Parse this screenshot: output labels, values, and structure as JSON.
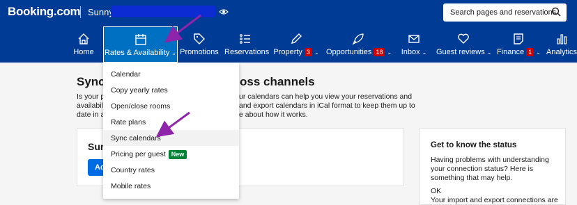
{
  "header": {
    "logo": "Booking.com",
    "property_name": "Sunny",
    "search_placeholder": "Search pages and reservations"
  },
  "nav": [
    {
      "label": "Home",
      "icon": "home-icon"
    },
    {
      "label": "Rates & Availability",
      "icon": "calendar-icon",
      "active": true
    },
    {
      "label": "Promotions",
      "icon": "tag-icon"
    },
    {
      "label": "Reservations",
      "icon": "list-icon"
    },
    {
      "label": "Property",
      "icon": "pencil-icon",
      "badge": "3"
    },
    {
      "label": "Opportunities",
      "icon": "rocket-icon",
      "badge": "18"
    },
    {
      "label": "Inbox",
      "icon": "envelope-icon"
    },
    {
      "label": "Guest reviews",
      "icon": "heart-icon"
    },
    {
      "label": "Finance",
      "icon": "document-icon",
      "badge": "1"
    },
    {
      "label": "Analytics",
      "icon": "bar-chart-icon"
    }
  ],
  "main": {
    "title_start": "Sync",
    "title_end": "oss channels",
    "intro": {
      "left_1": "Is your pr",
      "left_2": "availabili",
      "left_3": "date in all",
      "right_1": "ur calendars can help you view your reservations and",
      "right_2": "and export calendars in iCal format to keep them up to",
      "right_3": "e about how it works."
    },
    "card_left": {
      "title": "Sun",
      "button": "Ad"
    },
    "card_right": {
      "title": "Get to know the status",
      "body": "Having problems with understanding your connection status? Here is something that may help.",
      "ok": "OK",
      "more": "Your import and export connections are"
    }
  },
  "dropdown": {
    "items": [
      "Calendar",
      "Copy yearly rates",
      "Open/close rooms",
      "Rate plans",
      "Sync calendars",
      "Pricing per guest",
      "Country rates",
      "Mobile rates"
    ],
    "new_badge": "New"
  },
  "colors": {
    "header_bg": "#003b95",
    "active_tab": "#0071c2",
    "badge_red": "#cc0000",
    "new_green": "#008234",
    "annotation_arrow": "#8e24aa"
  }
}
